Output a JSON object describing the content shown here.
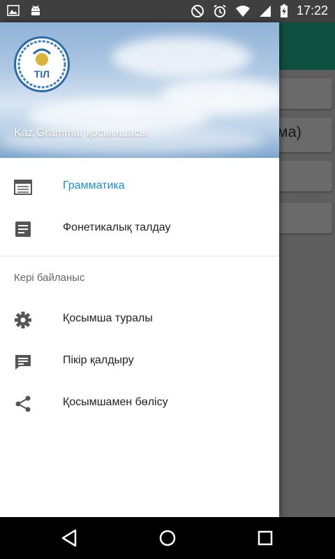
{
  "status_bar": {
    "time": "17:22",
    "left_icons": [
      "image-icon",
      "android-icon"
    ],
    "right_icons": [
      "do-not-disturb-icon",
      "alarm-icon",
      "wifi-icon",
      "signal-icon",
      "battery-charging-icon"
    ]
  },
  "drawer": {
    "header_title": "Kaz Grammar қосымшасы",
    "logo_text": "ТІЛ",
    "items": [
      {
        "label": "Грамматика",
        "icon": "calendar-view-icon",
        "active": true
      },
      {
        "label": "Фонетикалық талдау",
        "icon": "document-icon",
        "active": false
      }
    ],
    "section_title": "Кері байланыс",
    "feedback_items": [
      {
        "label": "Қосымша туралы",
        "icon": "gear-icon"
      },
      {
        "label": "Пікір қалдыру",
        "icon": "feedback-icon"
      },
      {
        "label": "Қосымшамен бөлісу",
        "icon": "share-icon"
      }
    ]
  },
  "background": {
    "partial_text": "ма)"
  },
  "nav_bar": {
    "buttons": [
      "back-icon",
      "home-icon",
      "recents-icon"
    ]
  },
  "colors": {
    "accent": "#1a8ee0",
    "toolbar": "#0f4f3f"
  }
}
